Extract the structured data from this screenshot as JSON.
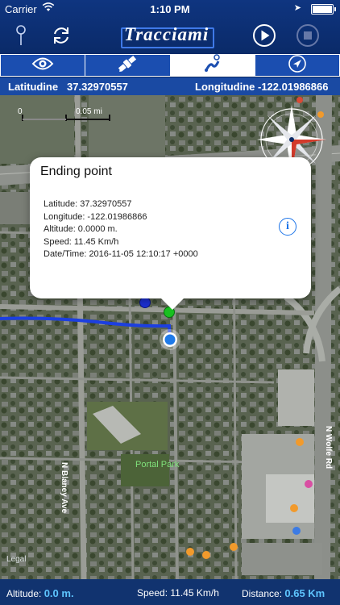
{
  "status": {
    "carrier": "Carrier",
    "time": "1:10 PM"
  },
  "nav": {
    "logo_text": "Tracciami"
  },
  "tabs": [
    {
      "icon": "eye-icon",
      "active": false
    },
    {
      "icon": "satellite-icon",
      "active": false
    },
    {
      "icon": "route-icon",
      "active": true
    },
    {
      "icon": "location-arrow-icon",
      "active": false
    }
  ],
  "coords": {
    "lat_label": "Latitudine",
    "lat_value": "37.32970557",
    "lon_label": "Longitudine",
    "lon_value": "-122.01986866"
  },
  "map": {
    "scale_left": "0",
    "scale_right": "0.05 mi",
    "street_1": "N Blaney Ave",
    "street_2": "N Wolfe Rd",
    "park": "Portal Park",
    "legal": "Legal",
    "compass_south": "S"
  },
  "popup": {
    "title": "Ending point",
    "latitude": "Latitude: 37.32970557",
    "longitude": "Longitude: -122.01986866",
    "altitude": "Altitude: 0.0000 m.",
    "speed": "Speed: 11.45 Km/h",
    "datetime": "Date/Time: 2016-11-05 12:10:17 +0000"
  },
  "bottom": {
    "altitude_label": "Altitude:",
    "altitude_value": "0.0 m.",
    "speed_label": "Speed:",
    "speed_value": "11.45 Km/h",
    "distance_label": "Distance:",
    "distance_value": "0.65 Km"
  },
  "colors": {
    "accent": "#1a4aa3",
    "track": "#1c3fe0",
    "value": "#5ec5ff"
  }
}
